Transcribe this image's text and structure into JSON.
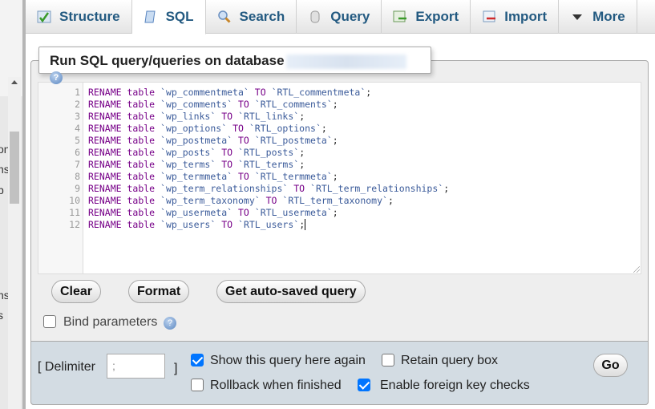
{
  "sidebar": {
    "fragments": [
      "on",
      "ns",
      "p",
      "ns",
      "s"
    ]
  },
  "tabs": [
    {
      "label": "Structure",
      "icon": "structure-icon"
    },
    {
      "label": "SQL",
      "icon": "sql-icon",
      "active": true
    },
    {
      "label": "Search",
      "icon": "search-icon"
    },
    {
      "label": "Query",
      "icon": "query-icon"
    },
    {
      "label": "Export",
      "icon": "export-icon"
    },
    {
      "label": "Import",
      "icon": "import-icon"
    },
    {
      "label": "More",
      "icon": "caret-down-icon"
    }
  ],
  "panel": {
    "title": "Run SQL query/queries on database",
    "database": "[blurred]"
  },
  "editor": {
    "lines": [
      [
        "wp_commentmeta",
        "RTL_commentmeta"
      ],
      [
        "wp_comments",
        "RTL_comments"
      ],
      [
        "wp_links",
        "RTL_links"
      ],
      [
        "wp_options",
        "RTL_options"
      ],
      [
        "wp_postmeta",
        "RTL_postmeta"
      ],
      [
        "wp_posts",
        "RTL_posts"
      ],
      [
        "wp_terms",
        "RTL_terms"
      ],
      [
        "wp_termmeta",
        "RTL_termmeta"
      ],
      [
        "wp_term_relationships",
        "RTL_term_relationships"
      ],
      [
        "wp_term_taxonomy",
        "RTL_term_taxonomy"
      ],
      [
        "wp_usermeta",
        "RTL_usermeta"
      ],
      [
        "wp_users",
        "RTL_users"
      ]
    ],
    "keyword_rename": "RENAME",
    "keyword_table": "table",
    "keyword_to": "TO"
  },
  "buttons": {
    "clear": "Clear",
    "format": "Format",
    "autosaved": "Get auto-saved query",
    "go": "Go"
  },
  "bind_parameters": {
    "label": "Bind parameters",
    "checked": false
  },
  "options": {
    "delimiter_label": "[ Delimiter",
    "delimiter_close": "]",
    "delimiter_value": ";",
    "show_query": {
      "label": "Show this query here again",
      "checked": true
    },
    "retain": {
      "label": "Retain query box",
      "checked": false
    },
    "rollback": {
      "label": "Rollback when finished",
      "checked": false
    },
    "foreign_keys": {
      "label": "Enable foreign key checks",
      "checked": true
    }
  },
  "colors": {
    "keyword": "#770088",
    "name": "#3b5b9a",
    "tab_text": "#235a81",
    "options_bg": "#d3dce3",
    "checkbox": "#0075ff"
  }
}
